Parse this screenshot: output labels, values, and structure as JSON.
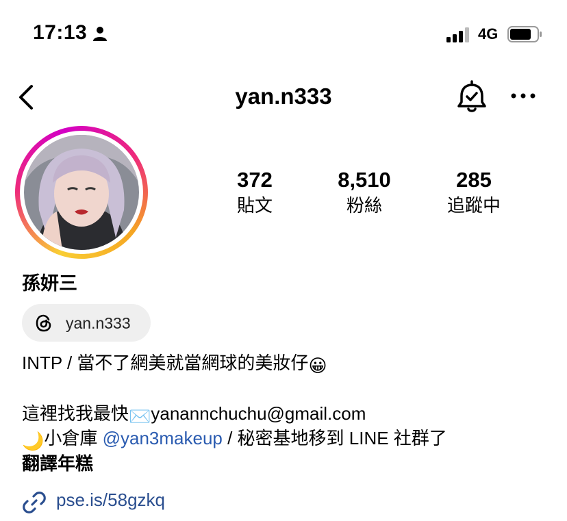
{
  "status_bar": {
    "time": "17:13",
    "network": "4G"
  },
  "header": {
    "username": "yan.n333",
    "icons": [
      "back-icon",
      "notification-bell-icon",
      "more-icon"
    ]
  },
  "profile": {
    "stats": [
      {
        "count": "372",
        "label": "貼文"
      },
      {
        "count": "8,510",
        "label": "粉絲"
      },
      {
        "count": "285",
        "label": "追蹤中"
      }
    ],
    "full_name": "孫妍三",
    "threads_handle": "yan.n333",
    "bio": {
      "line1_text": "INTP / 當不了網美就當網球的美妝仔",
      "line1_emoji": "😀",
      "line2_prefix": "這裡找我最快",
      "line2_emoji": "✉️",
      "line2_email": "yanannchuchu@gmail.com",
      "line3_emoji": "🌙",
      "line3_prefix": "小倉庫 ",
      "line3_mention": "@yan3makeup",
      "line3_suffix": " / 秘密基地移到 LINE 社群了",
      "line4_bold": "翻譯年糕"
    },
    "link": "pse.is/58gzkq"
  },
  "colors": {
    "link": "#2a4e8f",
    "mention": "#2a5bb0",
    "chip_bg": "#efefef"
  }
}
